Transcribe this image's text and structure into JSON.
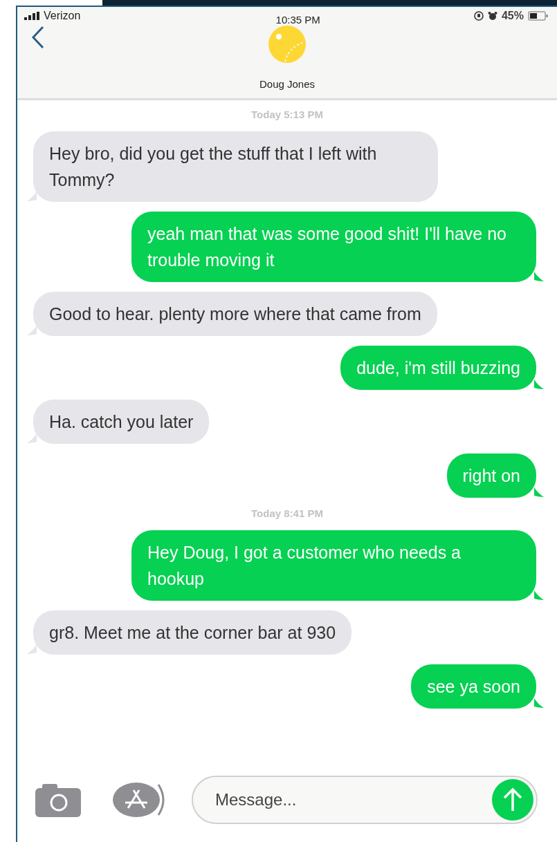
{
  "status_bar": {
    "carrier": "Verizon",
    "time": "10:35 PM",
    "battery": "45%"
  },
  "contact": {
    "name": "Doug Jones"
  },
  "messages": [
    {
      "kind": "timestamp",
      "text": "Today 5:13 PM"
    },
    {
      "kind": "incoming",
      "text": "Hey bro, did you get the stuff that I left with Tommy?"
    },
    {
      "kind": "outgoing",
      "text": "yeah man that was some good shit! I'll have no trouble moving it"
    },
    {
      "kind": "incoming",
      "text": "Good to hear. plenty more where that came from"
    },
    {
      "kind": "outgoing",
      "text": "dude, i'm still buzzing"
    },
    {
      "kind": "incoming",
      "text": "Ha. catch you later"
    },
    {
      "kind": "outgoing",
      "text": "right on"
    },
    {
      "kind": "timestamp",
      "text": "Today 8:41 PM"
    },
    {
      "kind": "outgoing",
      "text": "Hey Doug, I got a customer who needs a hookup"
    },
    {
      "kind": "incoming",
      "text": "gr8. Meet me at the corner bar at 930"
    },
    {
      "kind": "outgoing",
      "text": "see ya soon"
    }
  ],
  "composer": {
    "placeholder": "Message..."
  }
}
